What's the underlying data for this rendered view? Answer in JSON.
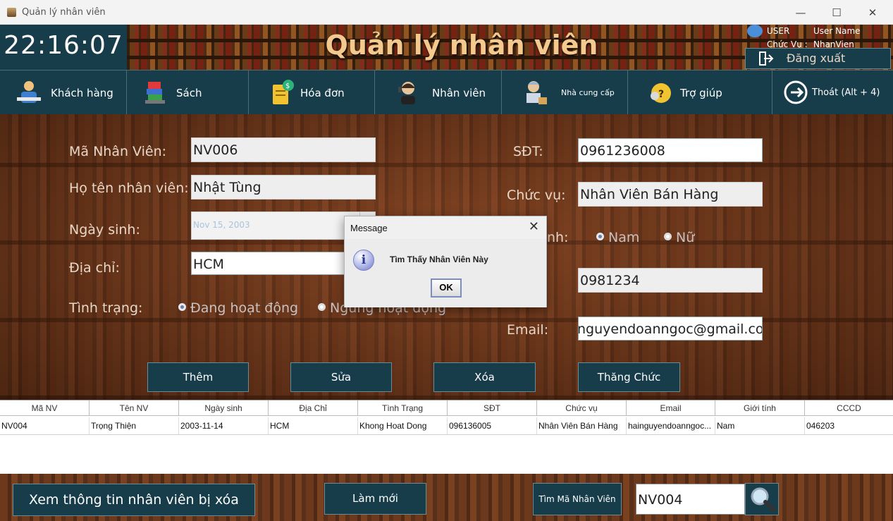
{
  "window": {
    "title": "Quản lý nhân viên",
    "min": "—",
    "max": "☐",
    "close": "✕"
  },
  "header": {
    "clock": "22:16:07",
    "app_title": "Quản lý nhân viên",
    "user_label": "USER",
    "user_name": "User Name",
    "role_label": "Chức Vụ :",
    "role_value": "NhanVien",
    "logout": "Đăng xuất"
  },
  "nav": [
    {
      "label": "Khách hàng",
      "icon": "customer-icon"
    },
    {
      "label": "Sách",
      "icon": "books-icon"
    },
    {
      "label": "Hóa đơn",
      "icon": "invoice-icon"
    },
    {
      "label": "Nhân viên",
      "icon": "employee-icon"
    },
    {
      "label": "Nhà cung cấp",
      "icon": "supplier-icon"
    },
    {
      "label": "Trợ giúp",
      "icon": "help-icon"
    },
    {
      "label": "Thoát (Alt + 4)",
      "icon": "exit-icon"
    }
  ],
  "form": {
    "id_label": "Mã Nhân Viên:",
    "id_value": "NV006",
    "name_label": "Họ tên nhân viên:",
    "name_value": "Nhật Tùng",
    "dob_label": "Ngày sinh:",
    "dob_value": "Nov 15, 2003",
    "address_label": "Địa chỉ:",
    "address_value": "HCM",
    "status_label": "Tình trạng:",
    "status_active": "Đang hoạt động",
    "status_inactive": "Ngừng hoạt động",
    "phone_label": "SĐT:",
    "phone_value": "0961236008",
    "position_label": "Chức vụ:",
    "position_value": "Nhân Viên Bán Hàng",
    "gender_label_fragment": "nh:",
    "gender_male": "Nam",
    "gender_female": "Nữ",
    "cccd_value": "0981234",
    "email_label": "Email:",
    "email_value": "nguyendoanngoc@gmail.com"
  },
  "actions": {
    "add": "Thêm",
    "edit": "Sửa",
    "delete": "Xóa",
    "promote": "Thăng Chức"
  },
  "table": {
    "columns": [
      "Mã NV",
      "Tên NV",
      "Ngày sinh",
      "Địa Chỉ",
      "Tình Trạng",
      "SĐT",
      "Chức vụ",
      "Email",
      "Giới tính",
      "CCCD"
    ],
    "rows": [
      [
        "NV004",
        "Trọng Thiện",
        "2003-11-14",
        "HCM",
        "Khong Hoat Dong",
        "096136005",
        "Nhân Viên Bán Hàng",
        "hainguyendoanngoc...",
        "Nam",
        "046203"
      ]
    ]
  },
  "bottom": {
    "view_deleted": "Xem thông tin nhân viên bị xóa",
    "refresh": "Làm mới",
    "search_type": "Tìm Mã Nhân Viên",
    "search_value": "NV004"
  },
  "dialog": {
    "title": "Message",
    "message": "Tìm Thấy Nhân Viên Này",
    "ok": "OK",
    "icon": "i"
  }
}
